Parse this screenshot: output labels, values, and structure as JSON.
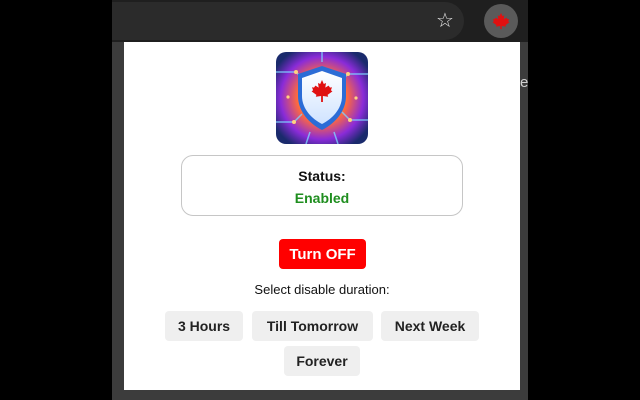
{
  "browser": {
    "star_icon": "star-outline-icon",
    "extension_icon": "maple-leaf-icon",
    "edge_text": "e"
  },
  "popup": {
    "logo_icon": "maple-leaf-shield-logo",
    "status": {
      "label": "Status:",
      "value": "Enabled",
      "value_color": "#1f8e1f"
    },
    "turn_off_label": "Turn OFF",
    "turn_off_color": "#ff0000",
    "duration_prompt": "Select disable duration:",
    "duration_options": [
      "3 Hours",
      "Till Tomorrow",
      "Next Week",
      "Forever"
    ]
  }
}
